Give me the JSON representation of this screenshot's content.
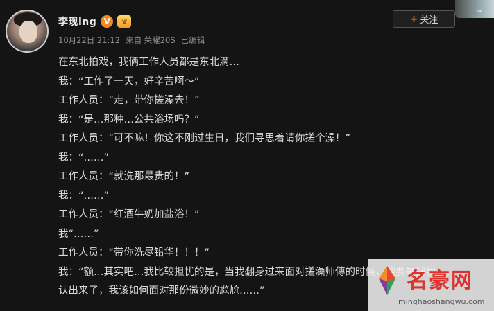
{
  "post": {
    "username": "李现ing",
    "verified_badge": "V",
    "member_badge": "crown-icon",
    "meta": {
      "date": "10月22日 21:12",
      "source": "来自 荣耀20S",
      "edited": "已编辑"
    },
    "follow_label": "关注",
    "lines": [
      "在东北拍戏，我俩工作人员都是东北滴…",
      "我：“工作了一天，好辛苦啊～”",
      "工作人员：“走，带你搓澡去！”",
      "我：“是…那种…公共浴场吗？”",
      "工作人员：“可不嘛！你这不刚过生日，我们寻思着请你搓个澡！”",
      "我：“……”",
      "工作人员：“就洗那最贵的！”",
      "我：“……”",
      "工作人员：“红酒牛奶加盐浴！”",
      "我“……”",
      "工作人员：“带你洗尽铅华！！！”",
      "我：“额…其实吧…我比较担忧的是，当我翻身过来面对搓澡师傅的时候，他要是把我",
      "认出来了，我该如何面对那份微妙的尴尬……”"
    ]
  },
  "watermark": {
    "title": "名豪网",
    "url": "minghaoshangwu.com"
  },
  "colors": {
    "background": "#141414",
    "text": "#dadada",
    "accent": "#ff8200",
    "watermark_red": "#e0322c"
  }
}
